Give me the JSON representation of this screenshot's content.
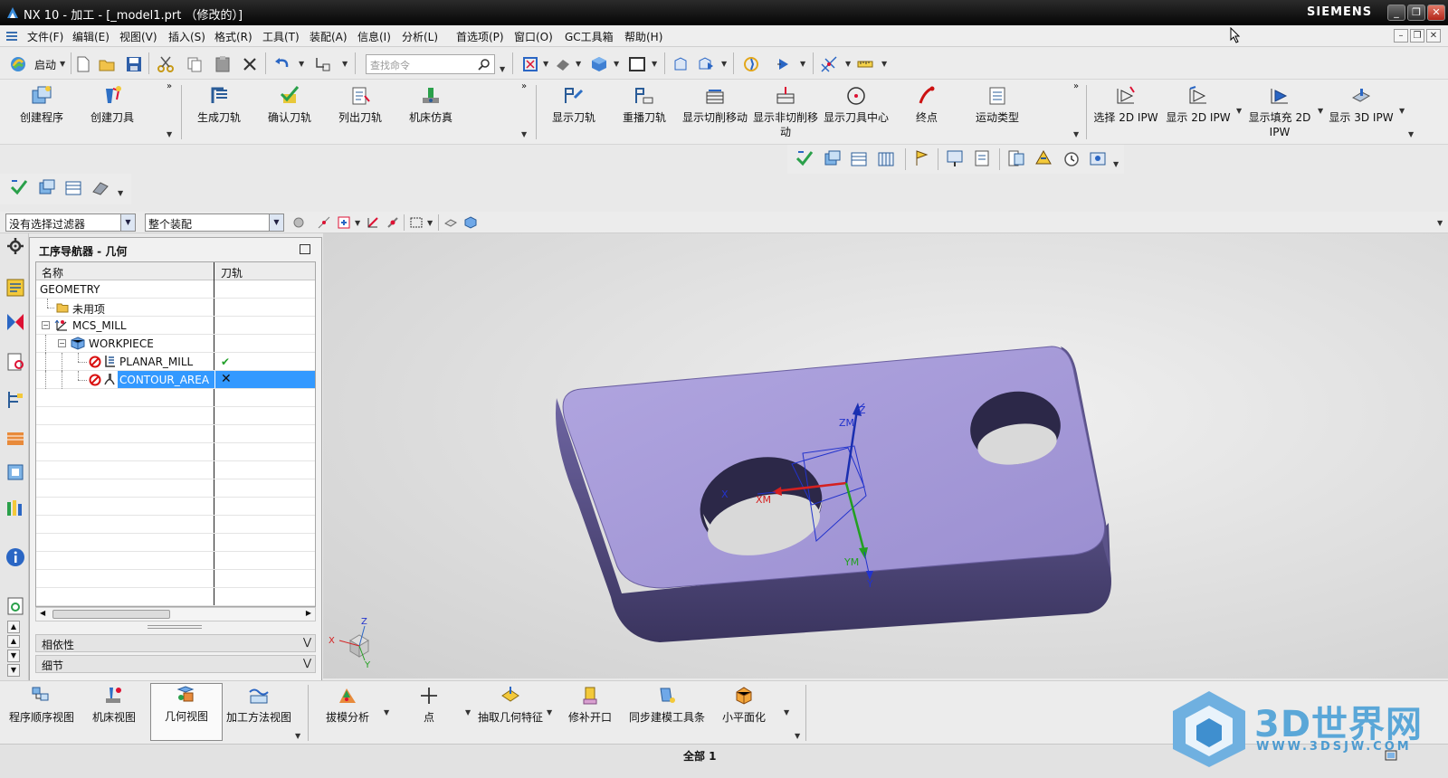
{
  "window": {
    "title": "NX 10 - 加工 - [_model1.prt （修改的）]",
    "brand": "SIEMENS",
    "controls": [
      "_",
      "❐",
      "✕"
    ]
  },
  "menu": {
    "items": [
      "文件(F)",
      "编辑(E)",
      "视图(V)",
      "插入(S)",
      "格式(R)",
      "工具(T)",
      "装配(A)",
      "信息(I)",
      "分析(L)",
      "首选项(P)",
      "窗口(O)",
      "GC工具箱",
      "帮助(H)"
    ]
  },
  "standard_toolbar": {
    "start_label": "启动",
    "search_placeholder": "查找命令"
  },
  "ribbon": {
    "group1": [
      "创建程序",
      "创建刀具"
    ],
    "group2": [
      "生成刀轨",
      "确认刀轨",
      "列出刀轨",
      "机床仿真"
    ],
    "group3": [
      "显示刀轨",
      "重播刀轨",
      "显示切削移动",
      "显示非切削移动",
      "显示刀具中心",
      "终点",
      "运动类型"
    ],
    "group4": [
      "选择 2D IPW",
      "显示 2D IPW",
      "显示填充 2D IPW",
      "显示 3D IPW"
    ]
  },
  "selection_bar": {
    "filter": "没有选择过滤器",
    "scope": "整个装配"
  },
  "navigator": {
    "title": "工序导航器 - 几何",
    "columns": [
      "名称",
      "刀轨"
    ],
    "rows": [
      {
        "name": "GEOMETRY",
        "path": ""
      },
      {
        "name": "未用项",
        "path": ""
      },
      {
        "name": "MCS_MILL",
        "path": ""
      },
      {
        "name": "WORKPIECE",
        "path": ""
      },
      {
        "name": "PLANAR_MILL",
        "path": "✔"
      },
      {
        "name": "CONTOUR_AREA",
        "path": "✕"
      }
    ],
    "sections": [
      "相依性",
      "细节"
    ]
  },
  "viewport": {
    "csys_labels": {
      "zm": "ZM",
      "z": "Z",
      "xm": "XM",
      "x": "X",
      "ym": "YM",
      "y": "Y"
    },
    "triad_labels": {
      "x": "X",
      "y": "Y",
      "z": "Z"
    },
    "part_color": "#a99ad8"
  },
  "bottom_toolbar": {
    "views": [
      "程序顺序视图",
      "机床视图",
      "几何视图",
      "加工方法视图"
    ],
    "tools": [
      "拔模分析",
      "点",
      "抽取几何特征",
      "修补开口",
      "同步建模工具条",
      "小平面化"
    ]
  },
  "status": {
    "message": "全部 1"
  },
  "watermark": {
    "text": "3D世界网",
    "url": "WWW.3DSJW.COM"
  }
}
